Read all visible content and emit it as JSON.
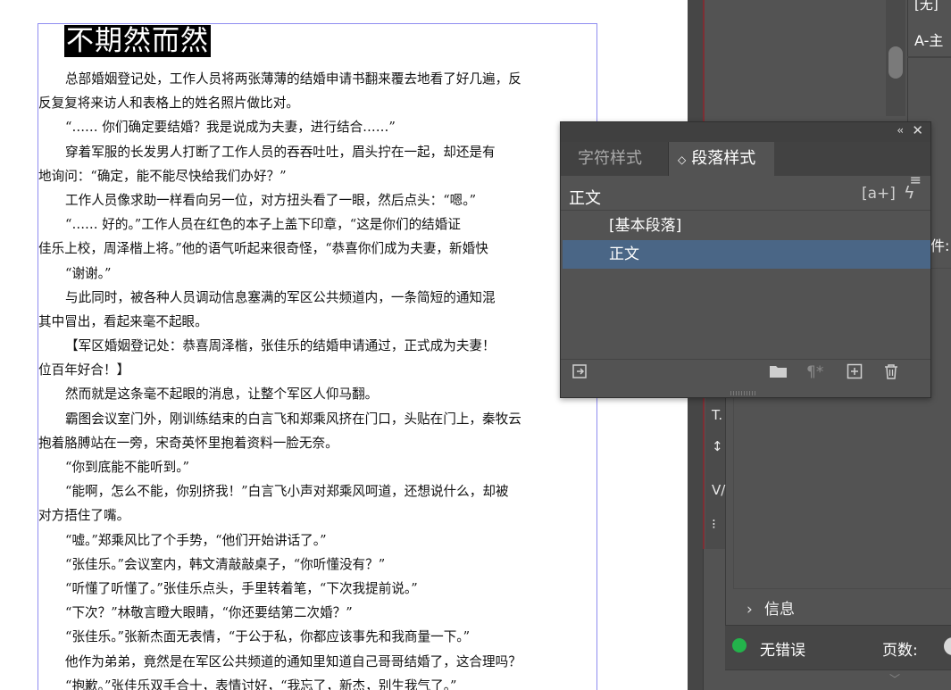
{
  "document": {
    "title": "不期然而然",
    "lines": [
      "总部婚姻登记处，工作人员将两张薄薄的结婚申请书翻来覆去地看了好几遍，反",
      "反复复将来访人和表格上的姓名照片做比对。",
      "“…… 你们确定要结婚？我是说成为夫妻，进行结合……”",
      "穿着军服的长发男人打断了工作人员的吞吞吐吐，眉头拧在一起，却还是有",
      "地询问：“确定，能不能尽快给我们办好？”",
      "工作人员像求助一样看向另一位，对方扭头看了一眼，然后点头：“嗯。”",
      "“…… 好的。”工作人员在红色的本子上盖下印章，“这是你们的结婚证",
      "佳乐上校，周泽楷上将。”他的语气听起来很奇怪，“恭喜你们成为夫妻，新婚快",
      "“谢谢。”",
      "与此同时，被各种人员调动信息塞满的军区公共频道内，一条简短的通知混",
      "其中冒出，看起来毫不起眼。",
      "【军区婚姻登记处：恭喜周泽楷，张佳乐的结婚申请通过，正式成为夫妻！",
      "位百年好合！】",
      "然而就是这条毫不起眼的消息，让整个军区人仰马翻。",
      "霸图会议室门外，刚训练结束的白言飞和郑乘风挤在门口，头贴在门上，秦牧云",
      "抱着胳膊站在一旁，宋奇英怀里抱着资料一脸无奈。",
      "“你到底能不能听到。”",
      "“能啊，怎么不能，你别挤我！”白言飞小声对郑乘风呵道，还想说什么，却被",
      "对方捂住了嘴。",
      "“嘘。”郑乘风比了个手势，“他们开始讲话了。”",
      "“张佳乐。”会议室内，韩文清敲敲桌子，“你听懂没有？”",
      "“听懂了听懂了。”张佳乐点头，手里转着笔，“下次我提前说。”",
      "“下次？”林敬言瞪大眼睛，“你还要结第二次婚？”",
      "“张佳乐。”张新杰面无表情，“于公于私，你都应该事先和我商量一下。”",
      "他作为弟弟，竟然是在军区公共频道的通知里知道自己哥哥结婚了，这合理吗？",
      "“抱歉。”张佳乐双手合十，表情讨好，“我忘了，新杰，别生我气了。”"
    ]
  },
  "indent_flags": [
    1,
    0,
    1,
    1,
    0,
    1,
    1,
    0,
    1,
    1,
    0,
    1,
    0,
    1,
    1,
    0,
    1,
    1,
    0,
    1,
    1,
    1,
    1,
    1,
    1,
    1
  ],
  "right_app": {
    "pages_top_label": "[无]",
    "master_label": "A-主",
    "props_partial_label": "件:",
    "info_label": "信息",
    "status_text": "无错误",
    "page_count_label": "页数:",
    "colors": {
      "status_ok": "#23b34b",
      "selection": "#4a6686",
      "panel_bg": "#535353"
    }
  },
  "paragraph_styles_panel": {
    "tabs": [
      {
        "label": "字符样式",
        "active": false
      },
      {
        "label": "段落样式",
        "active": true
      }
    ],
    "active_tab_icon": "◇",
    "current_style": "正文",
    "styles": [
      {
        "label": "[基本段落]",
        "selected": false
      },
      {
        "label": "正文",
        "selected": true
      }
    ],
    "icons": {
      "collapse": "double-chevron-left-icon",
      "close": "close-icon",
      "menu": "hamburger-menu-icon",
      "new_style_from_selection": "bracket-a-plus-icon",
      "quick_apply": "lightning-icon",
      "load_styles": "load-styles-icon",
      "new_group": "folder-icon",
      "clear_overrides": "pilcrow-clear-icon",
      "new_style": "plus-square-icon",
      "delete": "trash-icon"
    }
  }
}
